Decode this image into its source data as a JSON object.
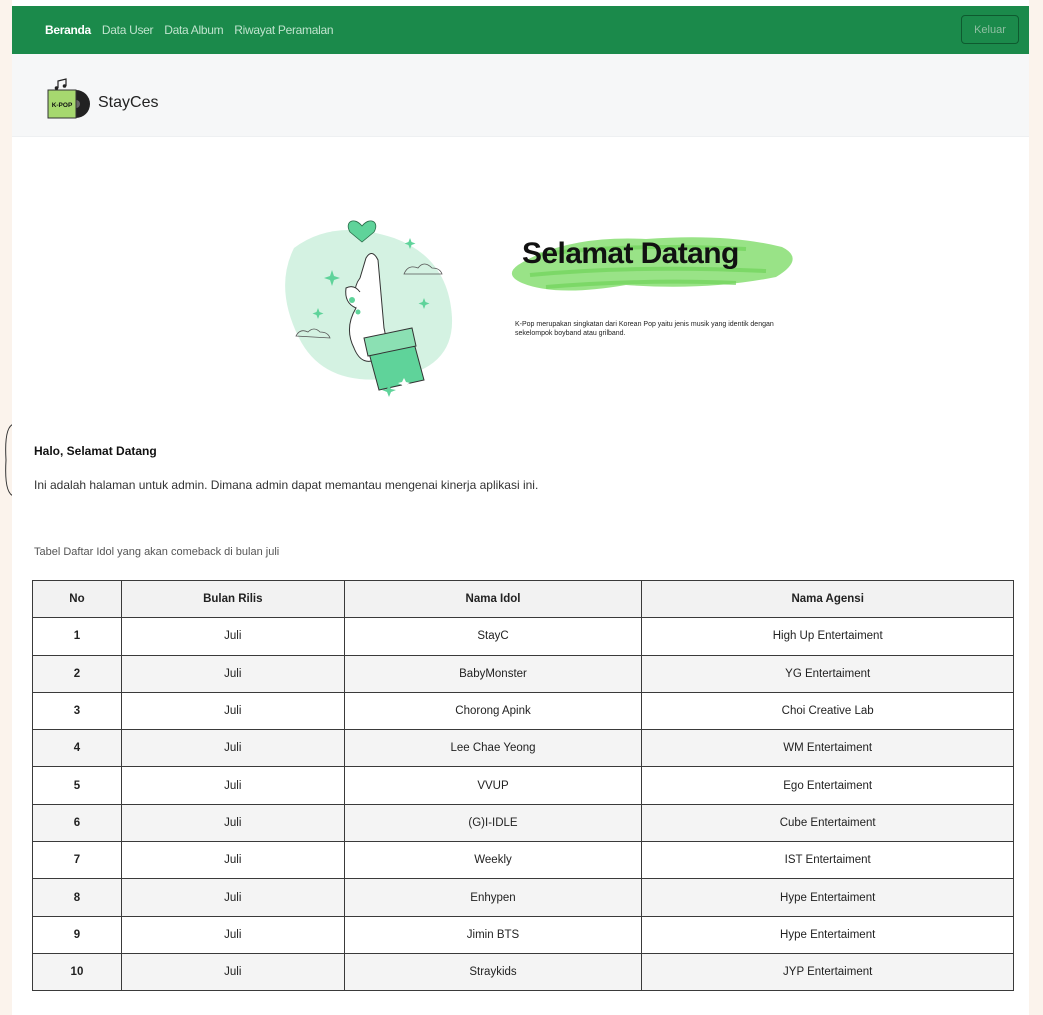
{
  "nav": {
    "links": [
      "Beranda",
      "Data User",
      "Data Album",
      "Riwayat Peramalan"
    ],
    "logout_label": "Keluar"
  },
  "brand": {
    "name": "StayCes",
    "logo_text": "K-POP",
    "logo_icon": "music-vinyl-icon"
  },
  "hero": {
    "title": "Selamat Datang",
    "text": "K-Pop merupakan singkatan dari Korean Pop yaitu jenis musik yang identik dengan sekelompok boyband atau grilband."
  },
  "greeting": {
    "title": "Halo, Selamat Datang",
    "text": "Ini adalah halaman untuk admin. Dimana admin dapat memantau mengenai kinerja aplikasi ini."
  },
  "table": {
    "caption": "Tabel Daftar Idol yang akan comeback di bulan juli",
    "headers": [
      "No",
      "Bulan Rilis",
      "Nama Idol",
      "Nama Agensi"
    ],
    "rows": [
      [
        "1",
        "Juli",
        "StayC",
        "High Up Entertaiment"
      ],
      [
        "2",
        "Juli",
        "BabyMonster",
        "YG Entertaiment"
      ],
      [
        "3",
        "Juli",
        "Chorong Apink",
        "Choi Creative Lab"
      ],
      [
        "4",
        "Juli",
        "Lee Chae Yeong",
        "WM Entertaiment"
      ],
      [
        "5",
        "Juli",
        "VVUP",
        "Ego Entertaiment"
      ],
      [
        "6",
        "Juli",
        "(G)I-IDLE",
        "Cube Entertaiment"
      ],
      [
        "7",
        "Juli",
        "Weekly",
        "IST Entertaiment"
      ],
      [
        "8",
        "Juli",
        "Enhypen",
        "Hype Entertaiment"
      ],
      [
        "9",
        "Juli",
        "Jimin BTS",
        "Hype Entertaiment"
      ],
      [
        "10",
        "Juli",
        "Straykids",
        "JYP Entertaiment"
      ]
    ]
  },
  "colors": {
    "nav_bg": "#1b8a4b",
    "accent_green": "#8ee07a",
    "illustration_mint": "#d4f2e2",
    "illustration_green": "#5fd39a"
  },
  "icons": {
    "illustration": "finger-heart-illustration",
    "sparkle": "sparkle-icon",
    "heart": "heart-icon",
    "cloud": "cloud-icon"
  }
}
